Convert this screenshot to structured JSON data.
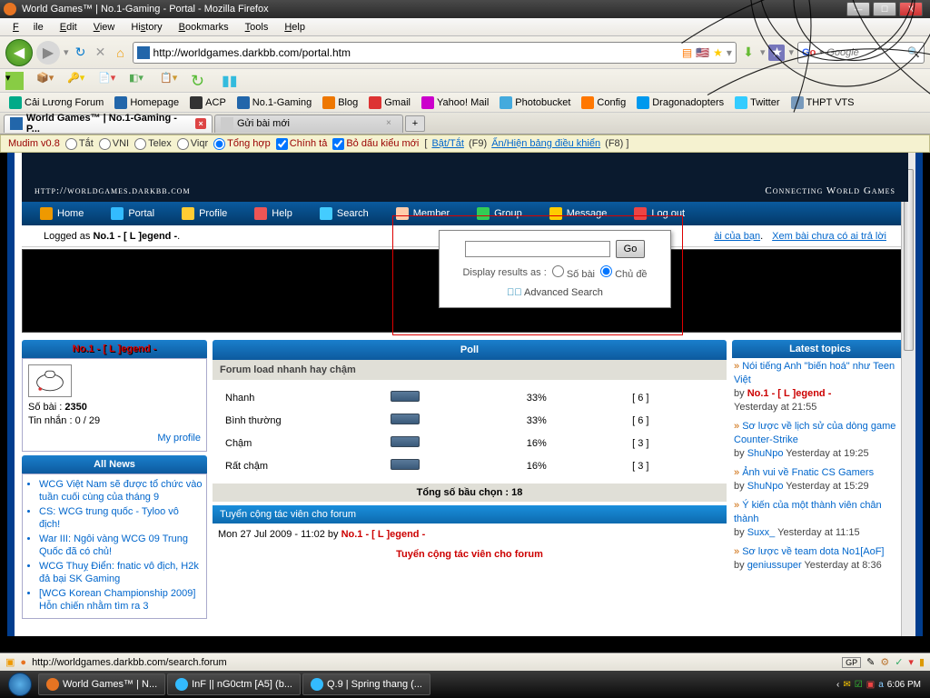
{
  "window": {
    "title": "World Games™ | No.1-Gaming - Portal - Mozilla Firefox"
  },
  "winbtns": {
    "min": "—",
    "max": "☐",
    "close": "X"
  },
  "menu": {
    "file": "File",
    "edit": "Edit",
    "view": "View",
    "history": "History",
    "bookmarks": "Bookmarks",
    "tools": "Tools",
    "help": "Help"
  },
  "nav": {
    "url": "http://worldgames.darkbb.com/portal.htm",
    "search_placeholder": "Google"
  },
  "bookmarks": [
    {
      "label": "Cải Lương Forum",
      "color": "#0a8"
    },
    {
      "label": "Homepage",
      "color": "#26a"
    },
    {
      "label": "ACP",
      "color": "#333"
    },
    {
      "label": "No.1-Gaming",
      "color": "#26a"
    },
    {
      "label": "Blog",
      "color": "#e70"
    },
    {
      "label": "Gmail",
      "color": "#d33"
    },
    {
      "label": "Yahoo! Mail",
      "color": "#c0c"
    },
    {
      "label": "Photobucket",
      "color": "#4ad"
    },
    {
      "label": "Config",
      "color": "#f70"
    },
    {
      "label": "Dragonadopters",
      "color": "#09e"
    },
    {
      "label": "Twitter",
      "color": "#3cf"
    },
    {
      "label": "THPT VTS",
      "color": "#79b"
    }
  ],
  "tabs": {
    "active": "World Games™ | No.1-Gaming - P...",
    "inactive": "Gửi bài mới"
  },
  "mudim": {
    "ver": "Mudim v0.8",
    "off": "Tắt",
    "vni": "VNI",
    "telex": "Telex",
    "viqr": "Viqr",
    "tonghop": "Tổng hợp",
    "chinhta": "Chính tả",
    "bodau": "Bỏ dấu kiểu mới",
    "toggle": "Bật/Tắt",
    "togglek": "(F9)",
    "panel": "Ẩn/Hiện bảng điều khiển",
    "panelk": "(F8)"
  },
  "banner": {
    "url": "http://worldgames.darkbb.com",
    "tag": "Connecting World Games"
  },
  "mainnav": [
    {
      "label": "Home",
      "color": "#e90"
    },
    {
      "label": "Portal",
      "color": "#3bf"
    },
    {
      "label": "Profile",
      "color": "#fc3"
    },
    {
      "label": "Help",
      "color": "#e55"
    },
    {
      "label": "Search",
      "color": "#4cf"
    },
    {
      "label": "Member",
      "color": "#fca"
    },
    {
      "label": "Group",
      "color": "#3c5"
    },
    {
      "label": "Message",
      "color": "#fc0"
    },
    {
      "label": "Log out",
      "color": "#e44"
    }
  ],
  "subbar": {
    "logged": "Logged as ",
    "user": "No.1 - [ L ]egend -",
    "dot": ".",
    "link1": "ài của bạn",
    "link2": "Xem bài chưa có ai trả lời"
  },
  "searchpop": {
    "go": "Go",
    "label": "Display results as : ",
    "opt1": "Số bài",
    "opt2": "Chủ đề",
    "adv": "Advanced Search"
  },
  "user": {
    "hdr": "No.1 - [ L ]egend -",
    "posts_l": "Số bài : ",
    "posts": "2350",
    "msg": "Tin nhắn : 0 / 29",
    "profile": "My profile"
  },
  "news": {
    "hdr": "All News",
    "items": [
      "WCG Việt Nam sẽ được tổ chức vào tuần cuối cùng của tháng 9",
      "CS: WCG trung quốc - Tyloo vô địch!",
      "War III: Ngôi vàng WCG 09 Trung Quốc đã có chủ!",
      "WCG Thuỵ Điển: fnatic vô địch, H2k đả bại SK Gaming",
      "[WCG Korean Championship 2009] Hỗn chiến nhằm tìm ra 3"
    ]
  },
  "poll": {
    "hdr": "Poll",
    "q": "Forum load nhanh hay chậm",
    "rows": [
      {
        "label": "Nhanh",
        "pct": "33%",
        "n": "[ 6 ]"
      },
      {
        "label": "Bình thường",
        "pct": "33%",
        "n": "[ 6 ]"
      },
      {
        "label": "Chậm",
        "pct": "16%",
        "n": "[ 3 ]"
      },
      {
        "label": "Rất chậm",
        "pct": "16%",
        "n": "[ 3 ]"
      }
    ],
    "total": "Tổng số bầu chọn : 18"
  },
  "post": {
    "hdr": "Tuyển cộng tác viên cho forum",
    "meta": "Mon 27 Jul 2009 - 11:02 by ",
    "author": "No.1 - [ L ]egend -",
    "title": "Tuyển cộng tác viên cho forum"
  },
  "topics": {
    "hdr": "Latest topics",
    "items": [
      {
        "t": "Nói tiếng Anh \"biến hoá\" như Teen Việt",
        "by": "by ",
        "a": "No.1 - [ L ]egend -",
        "d": "Yesterday at 21:55",
        "red": true
      },
      {
        "t": "Sơ lược về lịch sử của dòng game Counter-Strike",
        "by": "by ",
        "a": "ShuNpo",
        "d": " Yesterday at 19:25"
      },
      {
        "t": "Ảnh vui về Fnatic CS Gamers",
        "by": "by ",
        "a": "ShuNpo",
        "d": " Yesterday at 15:29"
      },
      {
        "t": "Ý kiến của một thành viên chân thành",
        "by": "by ",
        "a": "Suxx_",
        "d": " Yesterday at 11:15"
      },
      {
        "t": "Sơ lược về team dota No1[AoF]",
        "by": "by ",
        "a": "geniussuper",
        "d": " Yesterday at 8:36"
      }
    ]
  },
  "status": {
    "text": "http://worldgames.darkbb.com/search.forum",
    "gp": "GP"
  },
  "taskbar": {
    "btns": [
      {
        "label": "World Games™ | N...",
        "color": "#e77422"
      },
      {
        "label": "InF || nG0ctm [A5] (b...",
        "color": "#3bf"
      },
      {
        "label": "Q.9 | Spring thang (...",
        "color": "#3bf"
      }
    ],
    "time": "6:06 PM"
  }
}
